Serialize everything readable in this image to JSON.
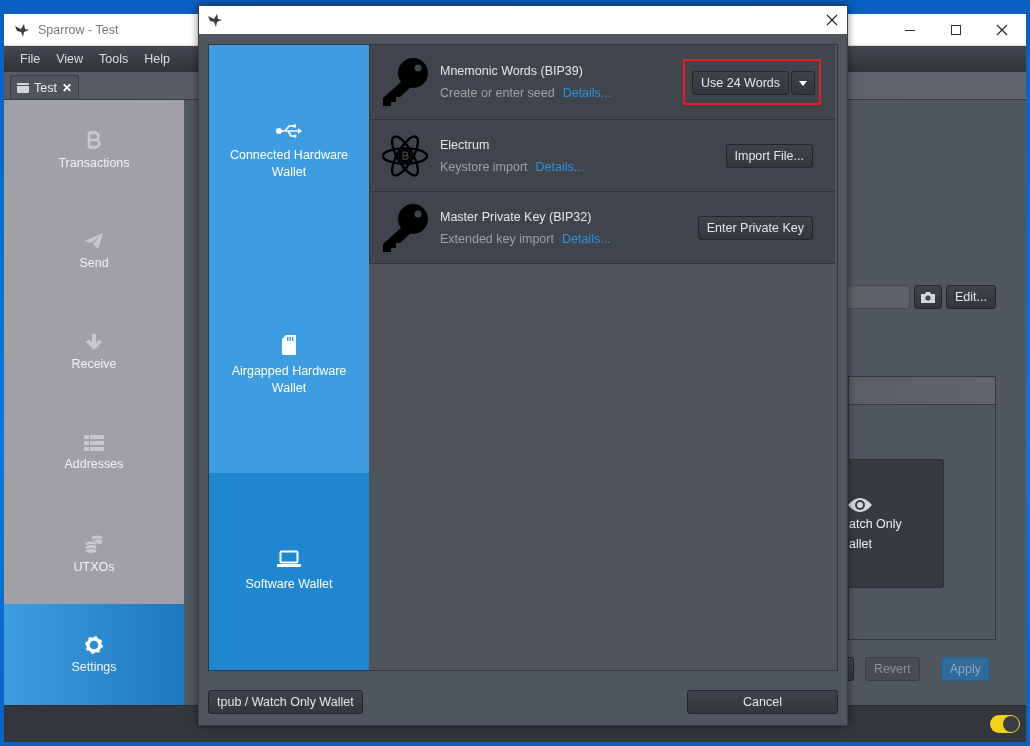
{
  "main_window": {
    "title": "Sparrow - Test",
    "menu": [
      "File",
      "View",
      "Tools",
      "Help"
    ],
    "tabs": [
      {
        "label": "Test",
        "close": "✕",
        "selected": true
      }
    ],
    "sidebar": [
      {
        "label": "Transactions",
        "selected": false
      },
      {
        "label": "Send",
        "selected": false
      },
      {
        "label": "Receive",
        "selected": false
      },
      {
        "label": "Addresses",
        "selected": false
      },
      {
        "label": "UTXOs",
        "selected": false
      },
      {
        "label": "Settings",
        "selected": true
      }
    ],
    "edit_button": "Edit...",
    "watch_only_card": [
      "atch Only",
      "allet"
    ],
    "buttons": [
      {
        "label": "Revert",
        "kind": "normal",
        "disabled": true
      },
      {
        "label": "Apply",
        "kind": "primary",
        "disabled": true
      }
    ],
    "theme_toggle": {
      "on": true
    }
  },
  "dialog": {
    "wallet_types": [
      {
        "label": "Connected Hardware Wallet",
        "selected": false
      },
      {
        "label": "Airgapped Hardware Wallet",
        "selected": false
      },
      {
        "label": "Software Wallet",
        "selected": true
      }
    ],
    "import_options": [
      {
        "title": "Mnemonic Words (BIP39)",
        "subtitle": "Create or enter seed",
        "link": "Details...",
        "button": "Use 24 Words",
        "kind": "split",
        "highlighted": true
      },
      {
        "title": "Electrum",
        "subtitle": "Keystore import",
        "link": "Details...",
        "button": "Import File...",
        "kind": "plain",
        "highlighted": false
      },
      {
        "title": "Master Private Key (BIP32)",
        "subtitle": "Extended key import",
        "link": "Details...",
        "button": "Enter Private Key",
        "kind": "plain",
        "highlighted": false
      }
    ],
    "footer": {
      "left_button": "tpub / Watch Only Wallet",
      "right_button": "Cancel"
    }
  }
}
